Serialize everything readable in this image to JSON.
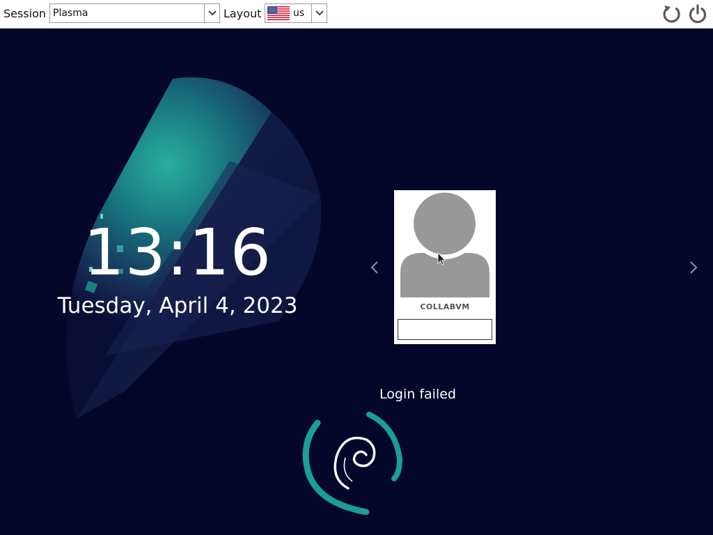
{
  "toolbar": {
    "session_label": "Session",
    "session_value": "Plasma",
    "layout_label": "Layout",
    "layout_value": "us",
    "reboot_icon": "reboot-icon",
    "shutdown_icon": "power-icon"
  },
  "clock": {
    "time": "13:16",
    "date": "Tuesday, April 4, 2023"
  },
  "user": {
    "name": "COLLABVM",
    "password_value": ""
  },
  "status": {
    "message": "Login failed"
  },
  "icons": {
    "prev": "chevron-left-icon",
    "next": "chevron-right-icon",
    "logo": "debian-swirl-icon"
  },
  "colors": {
    "background": "#05072a",
    "accent": "#1a9e98"
  }
}
